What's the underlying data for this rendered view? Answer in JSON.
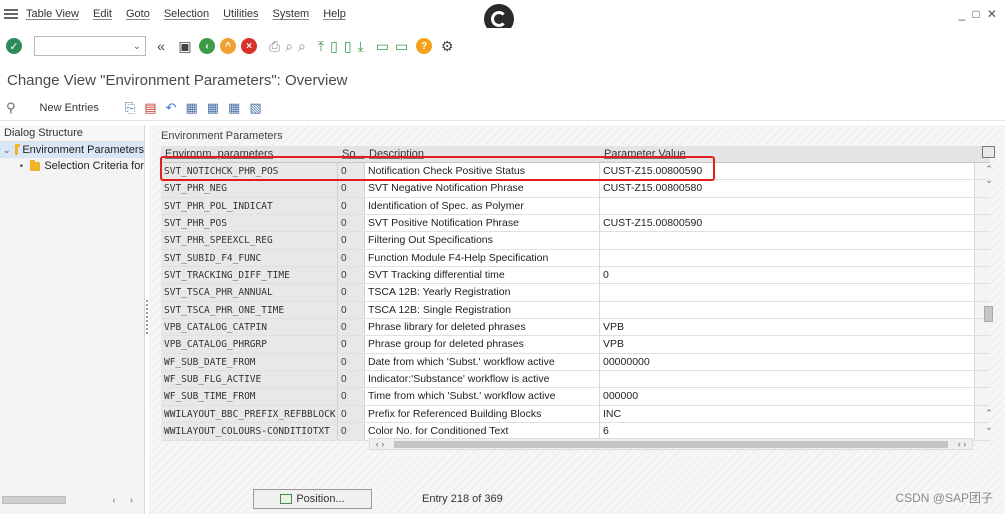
{
  "menubar": {
    "items": [
      "Table View",
      "Edit",
      "Goto",
      "Selection",
      "Utilities",
      "System",
      "Help"
    ],
    "window_controls": "_ □ ✕"
  },
  "toolbar": {
    "command_field_value": "",
    "icons": [
      "enter-check-icon",
      "back-icon",
      "save-icon",
      "back-green-icon",
      "exit-icon",
      "cancel-icon",
      "print-icon",
      "find-icon",
      "find-next-icon",
      "first-page-icon",
      "prev-page-icon",
      "next-page-icon",
      "last-page-icon",
      "create-session-icon",
      "shortcut-icon",
      "help-icon",
      "settings-icon"
    ]
  },
  "title": "Change View \"Environment Parameters\": Overview",
  "app_toolbar": {
    "new_entries_label": "New Entries"
  },
  "dialog_structure": {
    "header": "Dialog Structure",
    "items": [
      {
        "label": "Environment Parameters",
        "selected": true
      },
      {
        "label": "Selection Criteria for",
        "selected": false
      }
    ]
  },
  "table": {
    "caption": "Environment Parameters",
    "columns": [
      "Environm. parameters",
      "So...",
      "Description",
      "Parameter Value"
    ],
    "rows": [
      {
        "param": "SVT_NOTICHCK_PHR_POS",
        "seq": "0",
        "desc": "Notification Check Positive Status",
        "value": "CUST-Z15.00800590"
      },
      {
        "param": "SVT_PHR_NEG",
        "seq": "0",
        "desc": "SVT Negative Notification Phrase",
        "value": "CUST-Z15.00800580"
      },
      {
        "param": "SVT_PHR_POL_INDICAT",
        "seq": "0",
        "desc": "Identification of Spec. as Polymer",
        "value": ""
      },
      {
        "param": "SVT_PHR_POS",
        "seq": "0",
        "desc": "SVT Positive Notification Phrase",
        "value": "CUST-Z15.00800590"
      },
      {
        "param": "SVT_PHR_SPEEXCL_REG",
        "seq": "0",
        "desc": "Filtering Out Specifications",
        "value": ""
      },
      {
        "param": "SVT_SUBID_F4_FUNC",
        "seq": "0",
        "desc": "Function Module F4-Help Specification",
        "value": ""
      },
      {
        "param": "SVT_TRACKING_DIFF_TIME",
        "seq": "0",
        "desc": "SVT Tracking differential time",
        "value": "0"
      },
      {
        "param": "SVT_TSCA_PHR_ANNUAL",
        "seq": "0",
        "desc": "TSCA 12B: Yearly Registration",
        "value": ""
      },
      {
        "param": "SVT_TSCA_PHR_ONE_TIME",
        "seq": "0",
        "desc": "TSCA 12B: Single Registration",
        "value": ""
      },
      {
        "param": "VPB_CATALOG_CATPIN",
        "seq": "0",
        "desc": "Phrase library for deleted phrases",
        "value": "VPB"
      },
      {
        "param": "VPB_CATALOG_PHRGRP",
        "seq": "0",
        "desc": "Phrase group for deleted phrases",
        "value": "VPB"
      },
      {
        "param": "WF_SUB_DATE_FROM",
        "seq": "0",
        "desc": "Date from which 'Subst.' workflow active",
        "value": "00000000"
      },
      {
        "param": "WF_SUB_FLG_ACTIVE",
        "seq": "0",
        "desc": "Indicator:'Substance' workflow is active",
        "value": ""
      },
      {
        "param": "WF_SUB_TIME_FROM",
        "seq": "0",
        "desc": "Time from which 'Subst.' workflow active",
        "value": "000000"
      },
      {
        "param": "WWILAYOUT_BBC_PREFIX_REFBBLOCK",
        "seq": "0",
        "desc": "Prefix for Referenced Building Blocks",
        "value": "INC"
      },
      {
        "param": "WWILAYOUT_COLOURS-CONDITIOTXT",
        "seq": "0",
        "desc": "Color No. for Conditioned Text",
        "value": "6"
      }
    ]
  },
  "footer": {
    "position_label": "Position...",
    "entry_info": "Entry 218 of 369",
    "watermark": "CSDN @SAP团子"
  },
  "colors": {
    "highlight": "#e02020",
    "folder": "#f0b429",
    "enter_green": "#2e8b57"
  }
}
